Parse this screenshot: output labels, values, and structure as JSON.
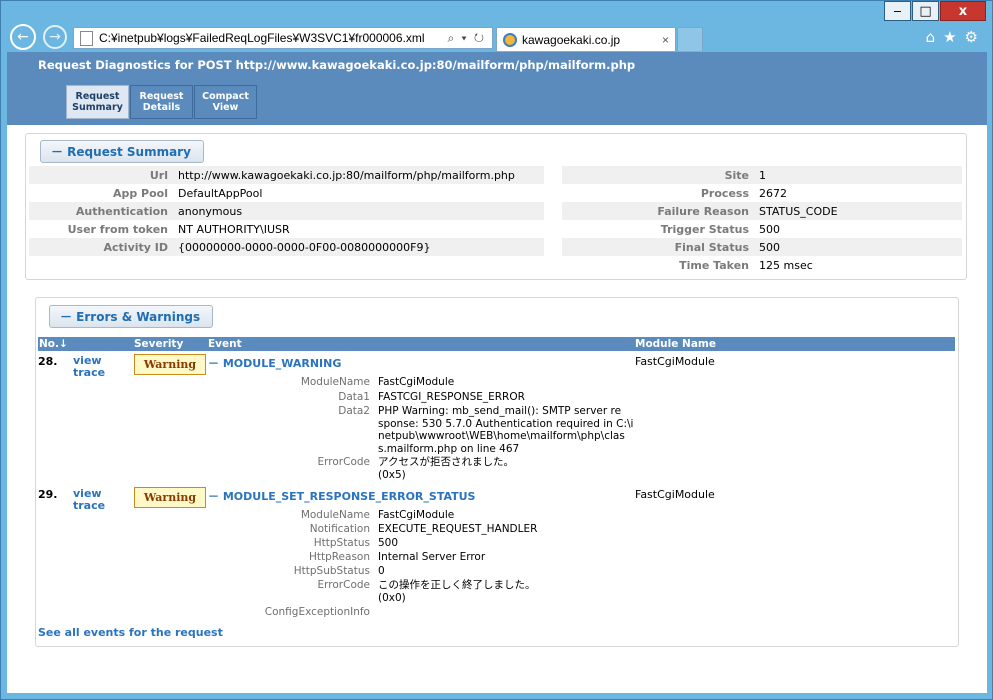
{
  "browser": {
    "address": "C:¥inetpub¥logs¥FailedReqLogFiles¥W3SVC1¥fr000006.xml",
    "tab_title": "kawagoekaki.co.jp",
    "min_glyph": "‒",
    "max_glyph": "□",
    "close_glyph": "x",
    "back_glyph": "←",
    "fwd_glyph": "→",
    "addr_controls": "⌕ ▾ ↻",
    "tab_close": "×",
    "home_glyph": "⌂",
    "star_glyph": "★",
    "gear_glyph": "⚙"
  },
  "page": {
    "title": "Request Diagnostics for POST http://www.kawagoekaki.co.jp:80/mailform/php/mailform.php",
    "tabs": [
      {
        "label1": "Request",
        "label2": "Summary"
      },
      {
        "label1": "Request",
        "label2": "Details"
      },
      {
        "label1": "Compact",
        "label2": "View"
      }
    ]
  },
  "summary": {
    "heading": "－ Request Summary",
    "left": [
      {
        "k": "Url",
        "v": "http://www.kawagoekaki.co.jp:80/mailform/php/mailform.php"
      },
      {
        "k": "App Pool",
        "v": "DefaultAppPool"
      },
      {
        "k": "Authentication",
        "v": "anonymous"
      },
      {
        "k": "User from token",
        "v": "NT AUTHORITY\\IUSR"
      },
      {
        "k": "Activity ID",
        "v": "{00000000-0000-0000-0F00-0080000000F9}"
      }
    ],
    "right": [
      {
        "k": "Site",
        "v": "1"
      },
      {
        "k": "Process",
        "v": "2672"
      },
      {
        "k": "Failure Reason",
        "v": "STATUS_CODE"
      },
      {
        "k": "Trigger Status",
        "v": "500"
      },
      {
        "k": "Final Status",
        "v": "500"
      },
      {
        "k": "Time Taken",
        "v": "125 msec"
      }
    ]
  },
  "errors": {
    "heading": "－ Errors & Warnings",
    "columns": {
      "no": "No.↓",
      "severity": "Severity",
      "event": "Event",
      "module": "Module Name"
    },
    "events": [
      {
        "no": "28.",
        "view1": "view",
        "view2": "trace",
        "severity": "Warning",
        "name": "－ MODULE_WARNING",
        "module": "FastCgiModule",
        "details": [
          {
            "k": "ModuleName",
            "v": [
              "FastCgiModule"
            ]
          },
          {
            "k": "Data1",
            "v": [
              "FASTCGI_RESPONSE_ERROR"
            ]
          },
          {
            "k": "Data2",
            "v": [
              "PHP Warning:  mb_send_mail(): SMTP server re",
              "sponse: 530 5.7.0 Authentication required in C:\\i",
              "netpub\\wwwroot\\WEB\\home\\mailform\\php\\clas",
              "s.mailform.php on line 467"
            ]
          },
          {
            "k": "ErrorCode",
            "v": [
              "アクセスが拒否されました。",
              " (0x5)"
            ]
          }
        ]
      },
      {
        "no": "29.",
        "view1": "view",
        "view2": "trace",
        "severity": "Warning",
        "name": "－ MODULE_SET_RESPONSE_ERROR_STATUS",
        "module": "FastCgiModule",
        "details": [
          {
            "k": "ModuleName",
            "v": [
              "FastCgiModule"
            ]
          },
          {
            "k": "Notification",
            "v": [
              "EXECUTE_REQUEST_HANDLER"
            ]
          },
          {
            "k": "HttpStatus",
            "v": [
              "500"
            ]
          },
          {
            "k": "HttpReason",
            "v": [
              "Internal Server Error"
            ]
          },
          {
            "k": "HttpSubStatus",
            "v": [
              "0"
            ]
          },
          {
            "k": "ErrorCode",
            "v": [
              "この操作を正しく終了しました。",
              " (0x0)"
            ]
          },
          {
            "k": "ConfigExceptionInfo",
            "v": [
              ""
            ]
          }
        ]
      }
    ],
    "see_all": "See all events for the request"
  }
}
